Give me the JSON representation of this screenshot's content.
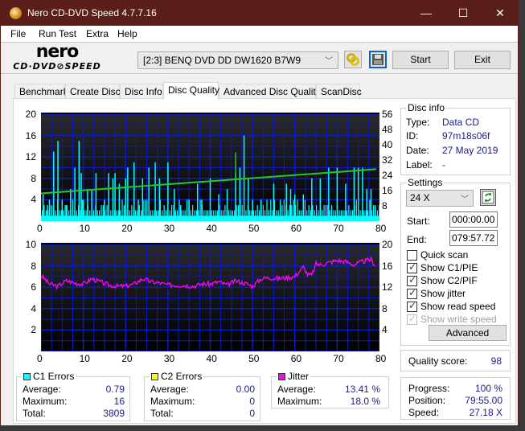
{
  "window": {
    "title": "Nero CD-DVD Speed 4.7.7.16",
    "controls": {
      "minimize": "—",
      "maximize": "☐",
      "close": "✕"
    }
  },
  "menu": [
    "File",
    "Run Test",
    "Extra",
    "Help"
  ],
  "toolbar": {
    "logo_top": "nero",
    "logo_bottom": "CD·DVD⊘SPEED",
    "drive": "[2:3]   BENQ DVD DD DW1620 B7W9",
    "start_label": "Start",
    "exit_label": "Exit",
    "icons": [
      "eject-swap-icon",
      "save-icon"
    ]
  },
  "tabs": [
    {
      "label": "Benchmark",
      "active": false
    },
    {
      "label": "Create Disc",
      "active": false
    },
    {
      "label": "Disc Info",
      "active": false
    },
    {
      "label": "Disc Quality",
      "active": true
    },
    {
      "label": "Advanced Disc Quality",
      "active": false
    },
    {
      "label": "ScanDisc",
      "active": false
    }
  ],
  "disc_info": {
    "title": "Disc info",
    "type_label": "Type:",
    "type": "Data CD",
    "id_label": "ID:",
    "id": "97m18s06f",
    "date_label": "Date:",
    "date": "27 May 2019",
    "label_label": "Label:",
    "label": "-"
  },
  "settings": {
    "title": "Settings",
    "speed": "24 X",
    "start_label": "Start:",
    "start": "000:00.00",
    "end_label": "End:",
    "end": "079:57.72",
    "checkboxes": [
      {
        "label": "Quick scan",
        "checked": false,
        "disabled": false
      },
      {
        "label": "Show C1/PIE",
        "checked": true,
        "disabled": false
      },
      {
        "label": "Show C2/PIF",
        "checked": true,
        "disabled": false
      },
      {
        "label": "Show jitter",
        "checked": true,
        "disabled": false
      },
      {
        "label": "Show read speed",
        "checked": true,
        "disabled": false
      },
      {
        "label": "Show write speed",
        "checked": true,
        "disabled": true
      }
    ],
    "advanced_label": "Advanced"
  },
  "quality": {
    "label": "Quality score:",
    "value": "98"
  },
  "progress": {
    "progress_label": "Progress:",
    "progress": "100 %",
    "position_label": "Position:",
    "position": "79:55.00",
    "speed_label": "Speed:",
    "speed": "27.18 X"
  },
  "stats": {
    "c1": {
      "title": "C1 Errors",
      "color": "#00ffff",
      "average_label": "Average:",
      "average": "0.79",
      "maximum_label": "Maximum:",
      "maximum": "16",
      "total_label": "Total:",
      "total": "3809"
    },
    "c2": {
      "title": "C2 Errors",
      "color": "#ffff00",
      "average_label": "Average:",
      "average": "0.00",
      "maximum_label": "Maximum:",
      "maximum": "0",
      "total_label": "Total:",
      "total": "0"
    },
    "jitter": {
      "title": "Jitter",
      "color": "#ff00ff",
      "average_label": "Average:",
      "average": "13.41 %",
      "maximum_label": "Maximum:",
      "maximum": "18.0 %"
    }
  },
  "chart_data": [
    {
      "type": "bar",
      "title": "C1/C2 errors with read speed",
      "xlim": [
        0,
        80
      ],
      "x_ticks": [
        "0",
        "10",
        "20",
        "30",
        "40",
        "50",
        "60",
        "70",
        "80"
      ],
      "ylim_left": [
        0,
        20
      ],
      "y_ticks_left": [
        "20",
        "16",
        "12",
        "8",
        "4"
      ],
      "ylim_right": [
        0,
        56
      ],
      "y_ticks_right": [
        "56",
        "48",
        "40",
        "32",
        "24",
        "16",
        "8"
      ],
      "grid": true,
      "series": [
        {
          "name": "C1 Errors",
          "color": "#00ffff",
          "baseline": 1,
          "spikes": [
            [
              0.5,
              5
            ],
            [
              1.5,
              3
            ],
            [
              2,
              4
            ],
            [
              3,
              13
            ],
            [
              4,
              15
            ],
            [
              5,
              4
            ],
            [
              6,
              3
            ],
            [
              7,
              6
            ],
            [
              8,
              10
            ],
            [
              9,
              15
            ],
            [
              9.5,
              9
            ],
            [
              10,
              4
            ],
            [
              11,
              6
            ],
            [
              12,
              6
            ],
            [
              13,
              9
            ],
            [
              15,
              4
            ],
            [
              16,
              9
            ],
            [
              17,
              8
            ],
            [
              17.5,
              9
            ],
            [
              18.5,
              7
            ],
            [
              20,
              8
            ],
            [
              20.5,
              10
            ],
            [
              22,
              11
            ],
            [
              23,
              4
            ],
            [
              24,
              8
            ],
            [
              25.5,
              10
            ],
            [
              27,
              11
            ],
            [
              28,
              8
            ],
            [
              30,
              11
            ],
            [
              31.5,
              6
            ],
            [
              33,
              3
            ],
            [
              35,
              4
            ],
            [
              37,
              7
            ],
            [
              38,
              4
            ],
            [
              40,
              8
            ],
            [
              42,
              5
            ],
            [
              44,
              6
            ],
            [
              46,
              9
            ],
            [
              47,
              10
            ],
            [
              48,
              16
            ],
            [
              49,
              8
            ],
            [
              50,
              4
            ],
            [
              52,
              4
            ],
            [
              55,
              7
            ],
            [
              58,
              7
            ],
            [
              59,
              6
            ],
            [
              60,
              5
            ],
            [
              62,
              5
            ],
            [
              64,
              8
            ],
            [
              66,
              8
            ],
            [
              68,
              10
            ],
            [
              70,
              10
            ],
            [
              72,
              7
            ],
            [
              74,
              10
            ],
            [
              75,
              10
            ],
            [
              76,
              10
            ],
            [
              77,
              6
            ],
            [
              78,
              6
            ],
            [
              79,
              3
            ]
          ]
        },
        {
          "name": "C2 Errors",
          "color": "#ffff00",
          "values": "all zero"
        },
        {
          "name": "Read speed",
          "color": "#22cc22",
          "axis": "right",
          "start": 14.5,
          "end": 27.2
        }
      ]
    },
    {
      "type": "line",
      "title": "Jitter",
      "xlim": [
        0,
        80
      ],
      "x_ticks": [
        "0",
        "10",
        "20",
        "30",
        "40",
        "50",
        "60",
        "70",
        "80"
      ],
      "ylim_left": [
        0,
        10
      ],
      "y_ticks_left": [
        "10",
        "8",
        "6",
        "4",
        "2"
      ],
      "ylim_right": [
        0,
        20
      ],
      "y_ticks_right": [
        "20",
        "16",
        "12",
        "8",
        "4"
      ],
      "grid": true,
      "series": [
        {
          "name": "Jitter",
          "color": "#ff00ff",
          "axis": "left",
          "points": [
            [
              0,
              7.1
            ],
            [
              2,
              6.3
            ],
            [
              4,
              6.1
            ],
            [
              6,
              6.6
            ],
            [
              8,
              6.4
            ],
            [
              10,
              6.3
            ],
            [
              12,
              6.8
            ],
            [
              14,
              6.5
            ],
            [
              16,
              6.2
            ],
            [
              18,
              6.1
            ],
            [
              20,
              6.1
            ],
            [
              22,
              6.3
            ],
            [
              24,
              6.8
            ],
            [
              26,
              6.5
            ],
            [
              28,
              6.4
            ],
            [
              30,
              6.2
            ],
            [
              32,
              6.2
            ],
            [
              34,
              6.2
            ],
            [
              36,
              6.1
            ],
            [
              38,
              6.3
            ],
            [
              40,
              6.3
            ],
            [
              42,
              6.5
            ],
            [
              44,
              6.2
            ],
            [
              46,
              6.6
            ],
            [
              48,
              6.4
            ],
            [
              50,
              6.1
            ],
            [
              52,
              6.8
            ],
            [
              54,
              6.9
            ],
            [
              56,
              6.8
            ],
            [
              58,
              6.9
            ],
            [
              60,
              7.0
            ],
            [
              62,
              7.9
            ],
            [
              63,
              7.2
            ],
            [
              64,
              7.1
            ],
            [
              65,
              8.2
            ],
            [
              66,
              8.1
            ],
            [
              68,
              8.3
            ],
            [
              70,
              8.5
            ],
            [
              72,
              8.4
            ],
            [
              74,
              8.1
            ],
            [
              76,
              8.4
            ],
            [
              78,
              8.6
            ],
            [
              79,
              8.0
            ]
          ]
        }
      ]
    }
  ]
}
